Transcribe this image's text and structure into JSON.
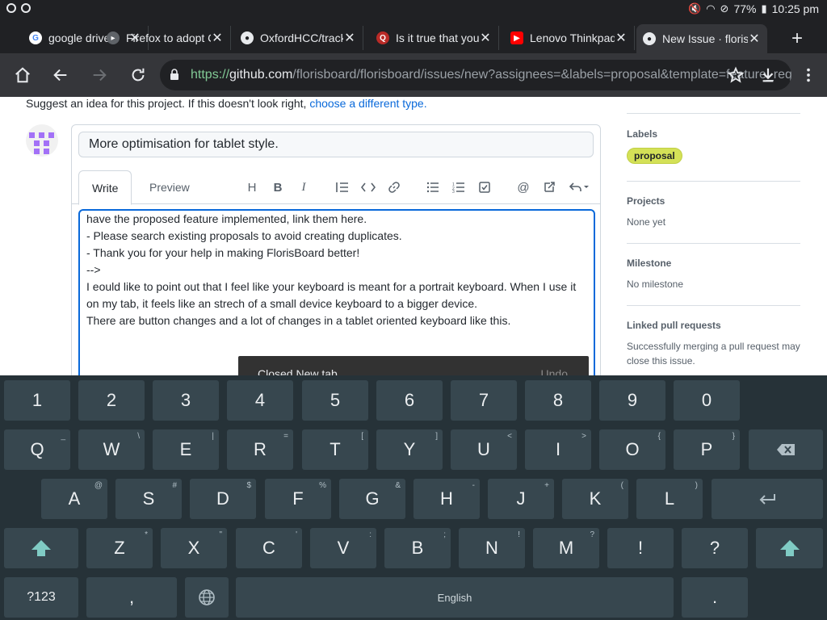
{
  "status": {
    "battery": "77%",
    "time": "10:25 pm"
  },
  "tabs": [
    {
      "title": "google drive",
      "favicon": "google-icon",
      "color": "#4285f4"
    },
    {
      "title": "Firefox to adopt Chrome",
      "favicon": "news-icon",
      "color": "#e8eaed"
    },
    {
      "title": "OxfordHCC/tracker",
      "favicon": "github-icon",
      "color": "#e8eaed"
    },
    {
      "title": "Is it true that you",
      "favicon": "quora-icon",
      "color": "#b92b27"
    },
    {
      "title": "Lenovo Thinkpad",
      "favicon": "youtube-icon",
      "color": "#ff0000"
    },
    {
      "title": "New Issue · florisboard",
      "favicon": "github-icon",
      "color": "#e8eaed"
    }
  ],
  "url": {
    "scheme": "https://",
    "host": "github.com",
    "path": "/florisboard/florisboard/issues/new?assignees=&labels=proposal&template=feature_request.md"
  },
  "page": {
    "suggest_text": "Suggest an idea for this project. If this doesn't look right,",
    "suggest_link": "choose a different type.",
    "title_value": "More optimisation for tablet style.",
    "write_tab": "Write",
    "preview_tab": "Preview",
    "body_lines": [
      "  have the proposed feature implemented, link them here.",
      "- Please search existing proposals to avoid creating duplicates.",
      "- Thank you for your help in making FlorisBoard better!",
      "-->",
      "I eould like to point out that I feel like your keyboard is meant for a portrait keyboard. When I use it",
      "on my tab, it feels like an strech of a small device keyboard to a bigger device.",
      "There are button changes and a lot of changes in a tablet oriented keyboard like this."
    ],
    "snackbar_text": "Closed New tab",
    "snackbar_action": "Undo"
  },
  "sidebar": {
    "labels_heading": "Labels",
    "label_chip": "proposal",
    "projects_heading": "Projects",
    "projects_value": "None yet",
    "milestone_heading": "Milestone",
    "milestone_value": "No milestone",
    "linked_heading": "Linked pull requests",
    "linked_value": "Successfully merging a pull request may close this issue."
  },
  "keyboard": {
    "row1": [
      "1",
      "2",
      "3",
      "4",
      "5",
      "6",
      "7",
      "8",
      "9",
      "0"
    ],
    "row2": [
      [
        "Q",
        "_"
      ],
      [
        "W",
        "\\"
      ],
      [
        "E",
        "|"
      ],
      [
        "R",
        "="
      ],
      [
        "T",
        "["
      ],
      [
        "Y",
        "]"
      ],
      [
        "U",
        "<"
      ],
      [
        "I",
        ">"
      ],
      [
        "O",
        "{"
      ],
      [
        "P",
        "}"
      ]
    ],
    "row3": [
      [
        "A",
        "@"
      ],
      [
        "S",
        "#"
      ],
      [
        "D",
        "$"
      ],
      [
        "F",
        "%"
      ],
      [
        "G",
        "&"
      ],
      [
        "H",
        "-"
      ],
      [
        "J",
        "+"
      ],
      [
        "K",
        "("
      ],
      [
        "L",
        ")"
      ]
    ],
    "row4": [
      [
        "Z",
        "*"
      ],
      [
        "X",
        "\""
      ],
      [
        "C",
        "'"
      ],
      [
        "V",
        ":"
      ],
      [
        "B",
        ";"
      ],
      [
        "N",
        "!"
      ],
      [
        "M",
        "?"
      ],
      [
        "!",
        ""
      ],
      [
        "?",
        ""
      ]
    ],
    "symbols_key": "?123",
    "comma_key": ",",
    "space_label": "English",
    "period_key": "."
  }
}
